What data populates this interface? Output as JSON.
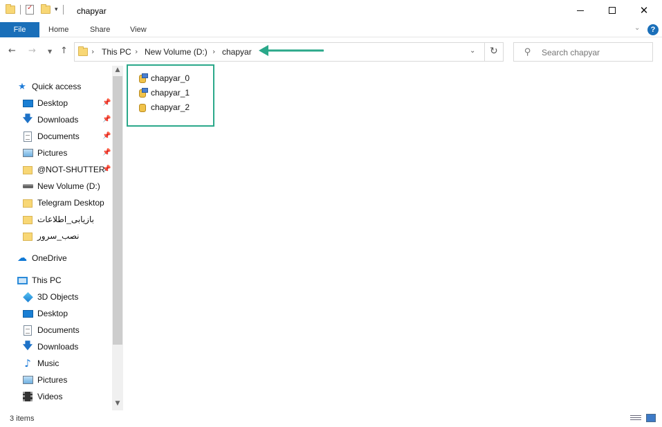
{
  "window": {
    "title": "chapyar"
  },
  "ribbon": {
    "tabs": [
      "File",
      "Home",
      "Share",
      "View"
    ],
    "help": "?"
  },
  "address": {
    "crumbs": [
      "This PC",
      "New Volume (D:)",
      "chapyar"
    ]
  },
  "search": {
    "placeholder": "Search chapyar"
  },
  "navpane": {
    "quick_access": "Quick access",
    "quick_items": [
      {
        "label": "Desktop",
        "icon": "desktop-icon",
        "pinned": true
      },
      {
        "label": "Downloads",
        "icon": "download-icon",
        "pinned": true
      },
      {
        "label": "Documents",
        "icon": "documents-icon",
        "pinned": true
      },
      {
        "label": "Pictures",
        "icon": "pictures-icon",
        "pinned": true
      },
      {
        "label": "@NOT-SHUTTER-",
        "icon": "folder-icon",
        "pinned": true
      },
      {
        "label": "New Volume (D:)",
        "icon": "drive-icon",
        "pinned": false
      },
      {
        "label": "Telegram Desktop",
        "icon": "folder-icon",
        "pinned": false
      },
      {
        "label": "بازیابی_اطلاعات",
        "icon": "folder-icon",
        "pinned": false
      },
      {
        "label": "نصب_سرور",
        "icon": "folder-icon",
        "pinned": false
      }
    ],
    "onedrive": "OneDrive",
    "this_pc": "This PC",
    "pc_items": [
      {
        "label": "3D Objects",
        "icon": "3d-objects-icon"
      },
      {
        "label": "Desktop",
        "icon": "desktop-icon"
      },
      {
        "label": "Documents",
        "icon": "documents-icon"
      },
      {
        "label": "Downloads",
        "icon": "download-icon"
      },
      {
        "label": "Music",
        "icon": "music-icon"
      },
      {
        "label": "Pictures",
        "icon": "pictures-icon"
      },
      {
        "label": "Videos",
        "icon": "videos-icon"
      }
    ]
  },
  "files": [
    {
      "name": "chapyar_0",
      "icon": "database-file-icon"
    },
    {
      "name": "chapyar_1",
      "icon": "database-file-icon"
    },
    {
      "name": "chapyar_2",
      "icon": "database-file-icon"
    }
  ],
  "status": {
    "count": "3 items"
  },
  "colors": {
    "accent": "#1a6fb9",
    "annotation": "#2aa88a",
    "folder": "#f8d775"
  }
}
